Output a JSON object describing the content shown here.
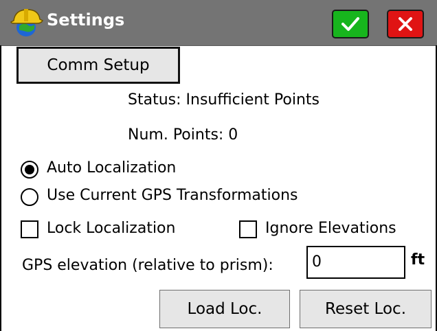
{
  "window": {
    "title": "Settings",
    "app_icon": "surveyor-helmet-globe-icon",
    "ok_icon": "checkmark-icon",
    "close_icon": "close-x-icon"
  },
  "colors": {
    "titlebar": "#747474",
    "ok_button": "#17b51d",
    "close_button": "#e01414",
    "button_face": "#e6e6e6"
  },
  "comm_setup": {
    "label": "Comm Setup"
  },
  "status": {
    "text": "Status: Insufficient Points"
  },
  "num_points": {
    "text": "Num. Points: 0"
  },
  "localization_mode": {
    "options": [
      {
        "label": "Auto Localization",
        "selected": true
      },
      {
        "label": "Use Current GPS Transformations",
        "selected": false
      }
    ]
  },
  "checkboxes": {
    "lock_localization": {
      "label": "Lock Localization",
      "checked": false
    },
    "ignore_elevations": {
      "label": "Ignore Elevations",
      "checked": false
    }
  },
  "gps_elevation": {
    "label": "GPS elevation (relative to prism):",
    "value": "0",
    "unit": "ft"
  },
  "actions": {
    "load_label": "Load Loc.",
    "reset_label": "Reset Loc."
  }
}
